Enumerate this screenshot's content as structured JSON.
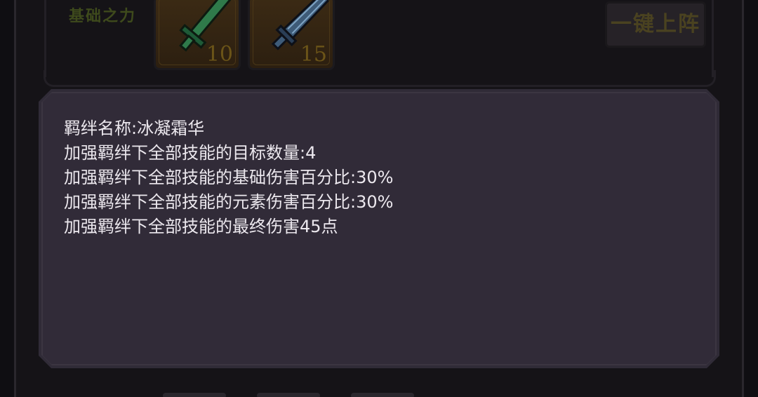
{
  "top_row": {
    "bond_label": "基础之力",
    "cards": [
      {
        "icon": "green-sword-icon",
        "count": "10"
      },
      {
        "icon": "blue-sword-icon",
        "count": "15"
      }
    ],
    "deploy_button_label": "一键上阵"
  },
  "info_panel": {
    "lines": [
      "羁绊名称:冰凝霜华",
      "加强羁绊下全部技能的目标数量:4",
      "加强羁绊下全部技能的基础伤害百分比:30%",
      "加强羁绊下全部技能的元素伤害百分比:30%",
      "加强羁绊下全部技能的最终伤害45点"
    ]
  },
  "colors": {
    "panel_bg": "#312b38",
    "panel_border": "#3b3541",
    "text": "#ece8ee",
    "muted_gold": "#6b5418"
  }
}
